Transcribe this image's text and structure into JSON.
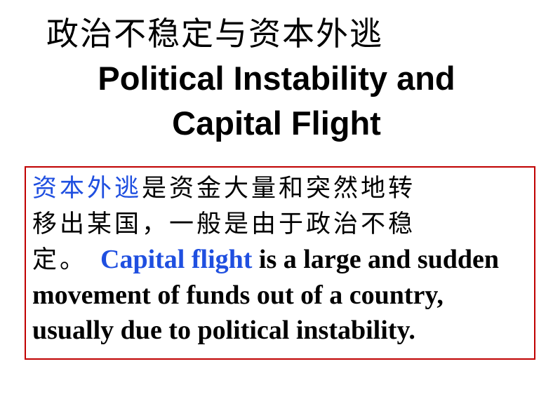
{
  "slide": {
    "title_zh": "政治不稳定与资本外逃",
    "title_en_line1": "Political Instability and",
    "title_en_line2": "Capital Flight",
    "definition": {
      "zh_term": "资本外逃",
      "zh_line1_rest": "是资金大量和突然地转",
      "zh_line2": "移出某国，一般是由于政治不稳",
      "zh_line3_start": "定。",
      "en_term": "Capital flight",
      "en_text": " is a large and sudden movement of funds out of a country, usually due to political instability."
    }
  },
  "colors": {
    "term": "#1f4fe0",
    "box_border": "#c00000",
    "text": "#000000"
  }
}
